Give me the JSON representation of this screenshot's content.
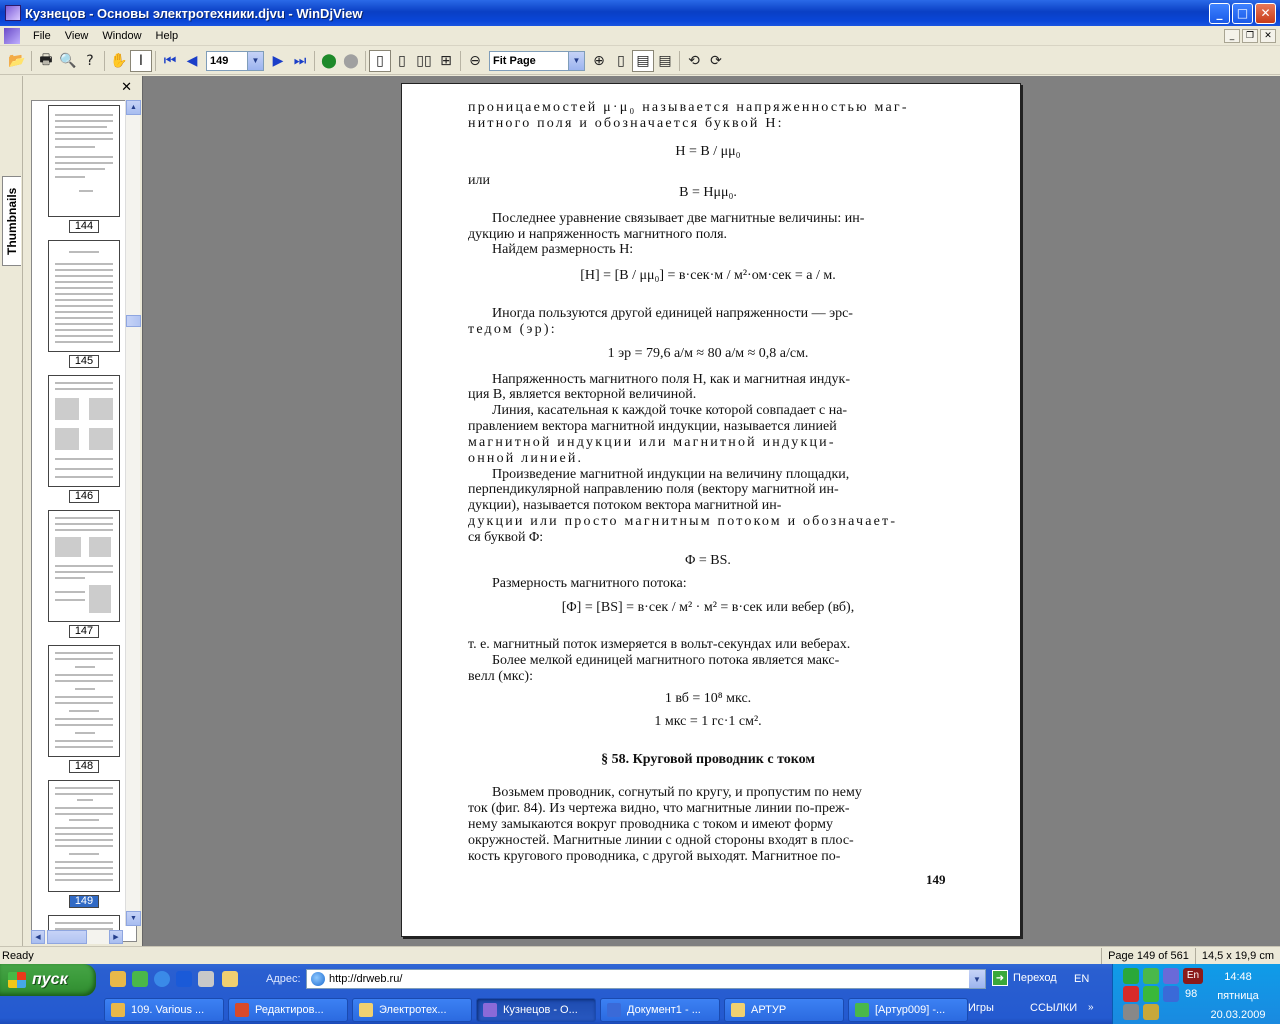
{
  "window": {
    "title": "Кузнецов - Основы электротехники.djvu - WinDjView",
    "btn_min": "_",
    "btn_max": "□",
    "btn_close": "✕"
  },
  "menu": {
    "items": [
      "File",
      "View",
      "Window",
      "Help"
    ],
    "mdi_min": "_",
    "mdi_restore": "❐",
    "mdi_close": "✕"
  },
  "toolbar": {
    "page_value": "149",
    "zoom_value": "Fit Page",
    "combo_arrow": "▼"
  },
  "sidebar": {
    "tab_label": "Thumbnails",
    "close": "✕",
    "thumbnails": [
      {
        "num": "144"
      },
      {
        "num": "145"
      },
      {
        "num": "146"
      },
      {
        "num": "147"
      },
      {
        "num": "148"
      },
      {
        "num": "149"
      }
    ],
    "selected": "149"
  },
  "document": {
    "lines": [
      {
        "text": "проницаемостей μ·μ₀ называется напряженностью маг-",
        "cls": "sp"
      },
      {
        "text": "нитного поля и обозначается буквой H:",
        "cls": "sp"
      },
      {
        "text": "H = B / μμ₀",
        "cls": "c"
      },
      {
        "text": "или",
        "cls": ""
      },
      {
        "text": "B = Hμμ₀.",
        "cls": "c"
      },
      {
        "text": "Последнее уравнение связывает две магнитные величины: ин-",
        "cls": "ind"
      },
      {
        "text": "дукцию и напряженность магнитного поля.",
        "cls": ""
      },
      {
        "text": "Найдем размерность H:",
        "cls": "ind"
      },
      {
        "text": "[H] = [B / μμ₀] = в·сек·м / м²·ом·сек = а / м.",
        "cls": "c"
      },
      {
        "text": "Иногда пользуются другой единицей напряженности — эрс-",
        "cls": "ind"
      },
      {
        "text": "тедом (эр):",
        "cls": "sp"
      },
      {
        "text": "1 эр = 79,6 а/м ≈ 80 а/м ≈ 0,8 а/см.",
        "cls": "c"
      },
      {
        "text": "Напряженность магнитного поля H, как и магнитная индук-",
        "cls": "ind"
      },
      {
        "text": "ция B, является векторной величиной.",
        "cls": ""
      },
      {
        "text": "Линия, касательная к каждой точке которой совпадает с на-",
        "cls": "ind"
      },
      {
        "text": "правлением вектора магнитной индукции, называется линией",
        "cls": ""
      },
      {
        "text": "магнитной индукции или магнитной индукци-",
        "cls": "sp"
      },
      {
        "text": "онной линией.",
        "cls": "sp"
      },
      {
        "text": "Произведение магнитной индукции на величину площадки,",
        "cls": "ind"
      },
      {
        "text": "перпендикулярной направлению поля (вектору магнитной ин-",
        "cls": ""
      },
      {
        "text": "дукции), называется потоком вектора магнитной ин-",
        "cls": ""
      },
      {
        "text": "дукции или просто магнитным потоком и обозначает-",
        "cls": "sp"
      },
      {
        "text": "ся буквой Φ:",
        "cls": ""
      },
      {
        "text": "Φ = BS.",
        "cls": "c"
      },
      {
        "text": "Размерность магнитного потока:",
        "cls": "ind"
      },
      {
        "text": "[Φ] = [BS] = в·сек / м² · м² = в·сек или вебер (вб),",
        "cls": "c"
      },
      {
        "text": "т. е. магнитный поток измеряется в вольт-секундах или веберах.",
        "cls": ""
      },
      {
        "text": "Более мелкой единицей магнитного потока является макс-",
        "cls": "ind"
      },
      {
        "text": "велл (мкс):",
        "cls": ""
      },
      {
        "text": "1 вб = 10⁸ мкс.",
        "cls": "c"
      },
      {
        "text": "1 мкс = 1 гс·1 см².",
        "cls": "c"
      },
      {
        "text": "§ 58. Круговой проводник с током",
        "cls": "c h"
      },
      {
        "text": "Возьмем проводник, согнутый по кругу, и пропустим по нему",
        "cls": "ind"
      },
      {
        "text": "ток (фиг. 84). Из чертежа видно, что магнитные линии по-преж-",
        "cls": ""
      },
      {
        "text": "нему замыкаются вокруг проводника с током и имеют форму",
        "cls": ""
      },
      {
        "text": "окружностей. Магнитные линии с одной стороны входят в плос-",
        "cls": ""
      },
      {
        "text": "кость кругового проводника, с другой выходят. Магнитное по-",
        "cls": ""
      }
    ],
    "page_number": "149"
  },
  "status": {
    "ready": "Ready",
    "page_info": "Page 149 of 561",
    "page_size": "14,5 x 19,9 cm"
  },
  "taskbar": {
    "start_label": "пуск",
    "address_label": "Адрес:",
    "address_url": "http://drweb.ru/",
    "go_label": "Переход",
    "lang": "EN",
    "tasks": [
      {
        "label": "109. Various ...",
        "color": "#e8b84a"
      },
      {
        "label": "Редактиров...",
        "color": "#d84a2a"
      },
      {
        "label": "Электротех...",
        "color": "#f0d070"
      },
      {
        "label": "Кузнецов - О...",
        "color": "#8a6ad8"
      },
      {
        "label": "Документ1 - ...",
        "color": "#3a6ad8"
      },
      {
        "label": "АРТУР",
        "color": "#f0d070"
      },
      {
        "label": "[Артур009] -...",
        "color": "#4ab84a"
      }
    ],
    "tray_games": "Игры",
    "tray_links": "ССЫЛКИ",
    "tray_en": "En",
    "tray_98": "98",
    "time": "14:48",
    "weekday": "пятница",
    "date": "20.03.2009"
  },
  "colors": {
    "title_bar": "#0a46d8",
    "selection": "#316ac5",
    "taskbar": "#245ad0",
    "start_green": "#3a9a3a"
  }
}
